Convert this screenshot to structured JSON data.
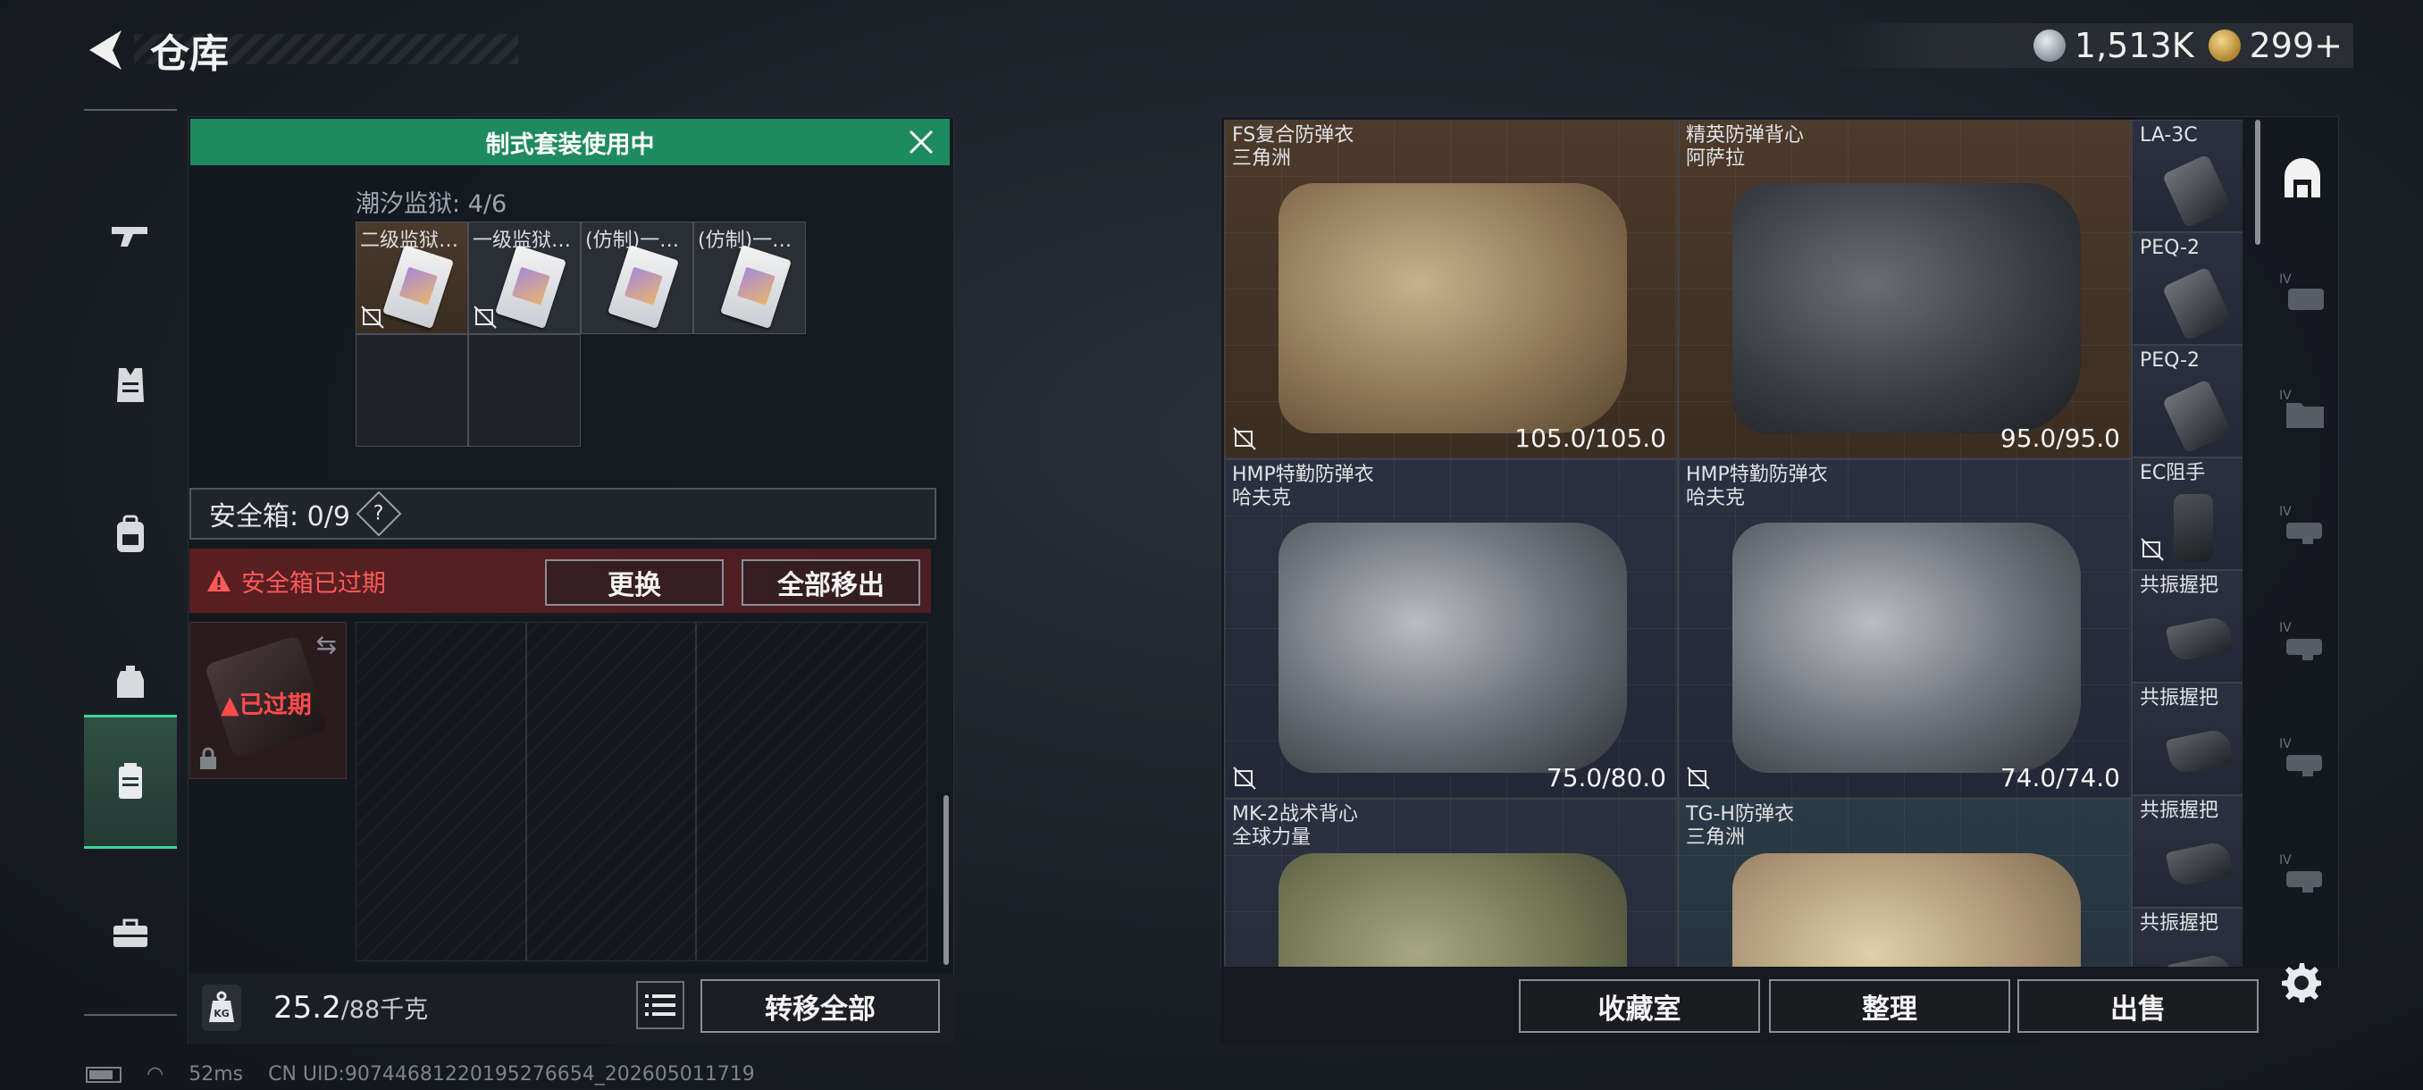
{
  "header": {
    "title": "仓库",
    "currency_silver": "1,513K",
    "currency_gold": "299+"
  },
  "left_nav": {
    "items": [
      {
        "icon": "gun-icon"
      },
      {
        "icon": "vest-icon"
      },
      {
        "icon": "backpack-icon"
      },
      {
        "icon": "rig-icon"
      },
      {
        "icon": "safe-case-icon",
        "active": true
      },
      {
        "icon": "toolbox-icon"
      }
    ]
  },
  "kit": {
    "banner": "制式套装使用中",
    "key_label": "潮汐监狱: 4/6",
    "keys": [
      {
        "name": "二级监狱…",
        "bg": "brown",
        "no_drop": true
      },
      {
        "name": "一级监狱…",
        "bg": "normal",
        "no_drop": true
      },
      {
        "name": "(仿制)一…",
        "bg": "normal",
        "no_drop": false
      },
      {
        "name": "(仿制)一…",
        "bg": "normal",
        "no_drop": false
      }
    ]
  },
  "safe": {
    "label": "安全箱: 0/9",
    "help": "?",
    "expired_warning": "安全箱已过期",
    "swap_label": "更换",
    "move_all_label": "全部移出",
    "icon_status": "已过期"
  },
  "footer_left": {
    "weight": "25.2",
    "weight_cap": "/88千克",
    "transfer_label": "转移全部"
  },
  "status": {
    "ping": "52ms",
    "uid": "CN UID:90744681220195276654_202605011719"
  },
  "inventory": {
    "big_items": [
      {
        "name": "FS复合防弹衣",
        "faction": "三角洲",
        "durability": "105.0/105.0",
        "color": "brown",
        "art": "tan"
      },
      {
        "name": "精英防弹背心",
        "faction": "阿萨拉",
        "durability": "95.0/95.0",
        "color": "brown",
        "art": "black"
      },
      {
        "name": "HMP特勤防弹衣",
        "faction": "哈夫克",
        "durability": "75.0/80.0",
        "color": "slate",
        "art": "grey"
      },
      {
        "name": "HMP特勤防弹衣",
        "faction": "哈夫克",
        "durability": "74.0/74.0",
        "color": "slate",
        "art": "grey"
      },
      {
        "name": "MK-2战术背心",
        "faction": "全球力量",
        "durability": "",
        "color": "slate",
        "art": "green"
      },
      {
        "name": "TG-H防弹衣",
        "faction": "三角洲",
        "durability": "",
        "color": "teal",
        "art": "desert"
      }
    ],
    "small_items": [
      {
        "name": "LA-3C",
        "art": "gadget"
      },
      {
        "name": "PEQ-2",
        "art": "gadget"
      },
      {
        "name": "PEQ-2",
        "art": "gadget"
      },
      {
        "name": "EC阻手",
        "art": "holster"
      },
      {
        "name": "共振握把",
        "art": "grip"
      },
      {
        "name": "共振握把",
        "art": "grip"
      },
      {
        "name": "共振握把",
        "art": "grip"
      },
      {
        "name": "共振握把",
        "art": "grip"
      }
    ]
  },
  "footer_right": {
    "collection_label": "收藏室",
    "sort_label": "整理",
    "sell_label": "出售"
  },
  "right_nav": {
    "tier_label": "IV",
    "items": [
      "armor-filter-icon",
      "helmet-filter-icon",
      "folder-filter-icon",
      "rig-filter-icon",
      "attachment-filter-icon",
      "attachment-filter-icon-2",
      "attachment-filter-icon-3"
    ]
  },
  "colors": {
    "accent_green": "#1e8a5f",
    "warning_red": "#ff5a5a",
    "panel_bg": "#14181e"
  }
}
